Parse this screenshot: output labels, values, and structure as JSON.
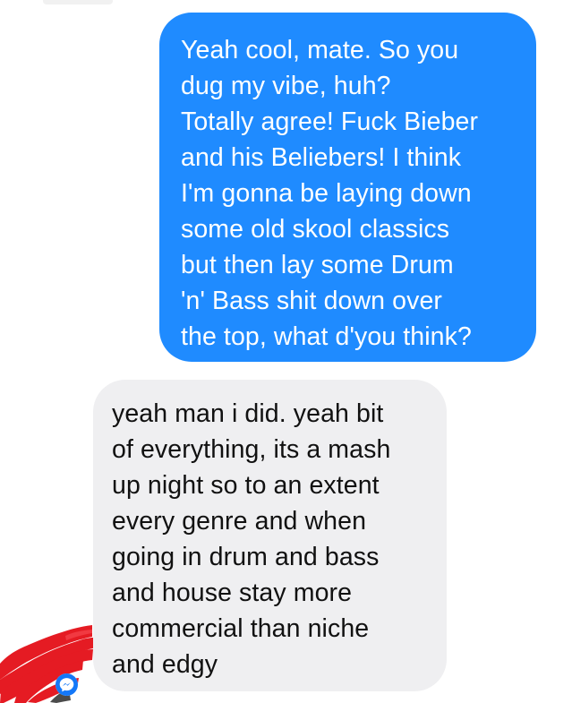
{
  "conversation": {
    "sent_message": {
      "lines": [
        "Yeah cool, mate. So you",
        "dug my vibe, huh?",
        "Totally agree! Fuck Bieber",
        "and his Beliebers! I think",
        "I'm gonna be laying down",
        "some old skool classics",
        "but then lay some Drum",
        "'n' Bass shit down over",
        "the top, what d'you think?"
      ]
    },
    "received_message": {
      "lines": [
        "yeah man i did. yeah bit",
        "of everything, its a mash",
        "up night so to an extent",
        "every genre and when",
        "going in drum and bass",
        "and house stay more",
        "commercial than niche",
        "and edgy"
      ]
    },
    "avatar": {
      "icon": "redacted-avatar-icon"
    },
    "messenger_badge": {
      "icon": "messenger-icon"
    }
  },
  "colors": {
    "sent_bubble": "#1f8bff",
    "received_bubble": "#efeff1",
    "sent_text": "#ffffff",
    "received_text": "#111111",
    "redaction": "#e51b23",
    "messenger_blue": "#1478f8"
  }
}
